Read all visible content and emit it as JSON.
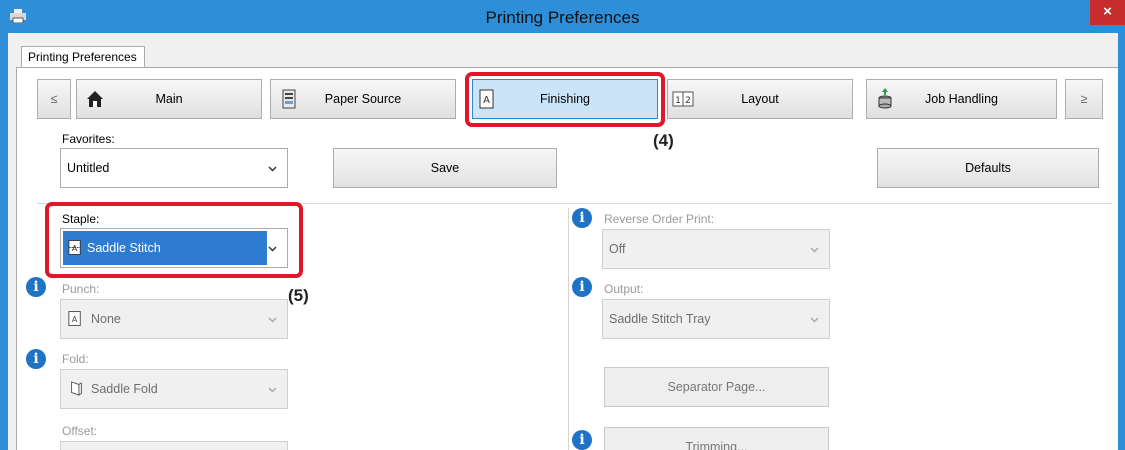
{
  "window": {
    "title": "Printing Preferences",
    "close_glyph": "×"
  },
  "outer_tab": {
    "label": "Printing Preferences"
  },
  "categories": {
    "prev": "≤",
    "next": "≥",
    "items": [
      {
        "label": "Main",
        "icon": "home-icon"
      },
      {
        "label": "Paper Source",
        "icon": "paper-tray-icon"
      },
      {
        "label": "Finishing",
        "icon": "finishing-page-icon",
        "selected": true
      },
      {
        "label": "Layout",
        "icon": "layout-pages-icon"
      },
      {
        "label": "Job Handling",
        "icon": "job-stack-icon"
      }
    ]
  },
  "favorites": {
    "label": "Favorites:",
    "value": "Untitled",
    "save": "Save",
    "defaults": "Defaults"
  },
  "staple": {
    "label": "Staple:",
    "value": "Saddle Stitch"
  },
  "punch": {
    "label": "Punch:",
    "value": "None"
  },
  "fold": {
    "label": "Fold:",
    "value": "Saddle Fold"
  },
  "offset": {
    "label": "Offset:"
  },
  "reverse_order": {
    "label": "Reverse Order Print:",
    "value": "Off"
  },
  "output": {
    "label": "Output:",
    "value": "Saddle Stitch Tray"
  },
  "separator_page": {
    "label": "Separator Page..."
  },
  "trimming": {
    "label": "Trimming..."
  },
  "callouts": {
    "c4": "(4)",
    "c5": "(5)"
  },
  "colors": {
    "titlebar": "#2f8ed8",
    "highlight": "#e0162b",
    "selected_tab": "#cce4f7",
    "selection": "#2d7cd1"
  }
}
